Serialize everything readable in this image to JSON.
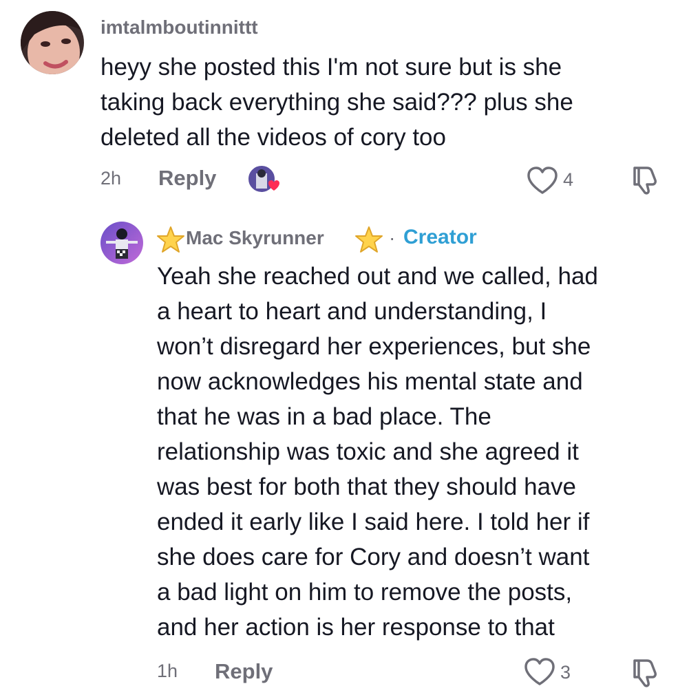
{
  "comment1": {
    "username": "imtalmboutinnittt",
    "lines": [
      "heyy she posted this I'm not sure but is she",
      "taking back everything she said??? plus she",
      "deleted all the videos of cory too"
    ],
    "time": "2h",
    "reply_label": "Reply",
    "like_count": "4"
  },
  "comment2": {
    "username": "Mac Skyrunner",
    "separator": "·",
    "badge": "Creator",
    "lines": [
      "Yeah she reached out and we called, had",
      "a heart to heart and understanding, I",
      "won’t disregard her experiences, but she",
      "now acknowledges his mental state and",
      "that he was in a bad place. The",
      "relationship was toxic and she agreed it",
      "was best for both that they should have",
      "ended it early like I said here. I told her if",
      "she does care for Cory and doesn’t want",
      "a bad light on him to remove the posts,",
      "and her action is her response to that"
    ],
    "time": "1h",
    "reply_label": "Reply",
    "like_count": "3"
  },
  "icons": {
    "like": "heart-outline-icon",
    "dislike": "thumbs-down-icon",
    "star": "star-emoji-icon",
    "creator_liked": "creator-liked-avatar-icon"
  },
  "colors": {
    "text_primary": "#161823",
    "text_secondary": "#6f6f78",
    "creator_badge": "#2f9fd4",
    "heart_red": "#fe2c55",
    "star_fill": "#ffd34d"
  }
}
